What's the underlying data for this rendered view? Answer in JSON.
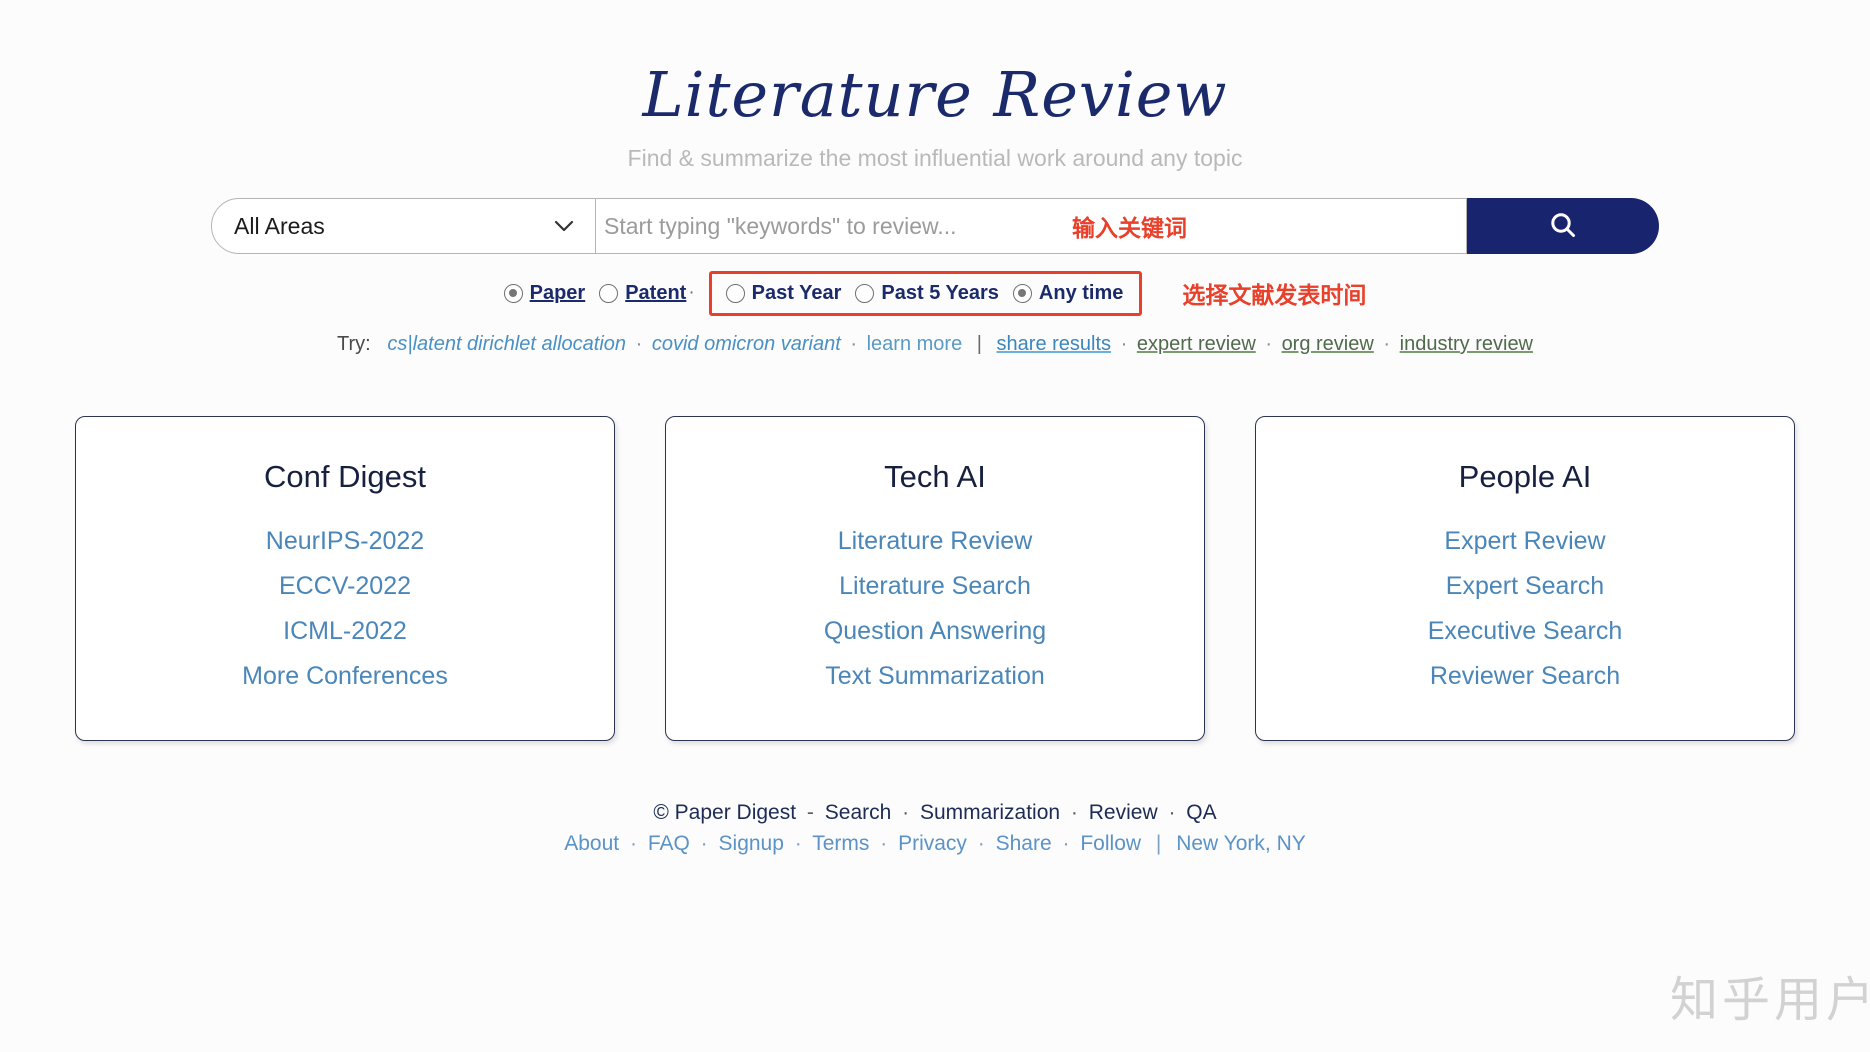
{
  "header": {
    "title": "Literature Review",
    "tagline": "Find & summarize the most influential work around any topic"
  },
  "search": {
    "area_selected": "All Areas",
    "area_options": [
      "All Areas"
    ],
    "placeholder": "Start typing \"keywords\" to review...",
    "value": "",
    "annotation_keyword": "输入关键词",
    "search_icon": "search-icon"
  },
  "filters": {
    "doc_types": [
      {
        "label": "Paper",
        "selected": true
      },
      {
        "label": "Patent",
        "selected": false
      }
    ],
    "separator": "·",
    "time_ranges": [
      {
        "label": "Past Year",
        "selected": false
      },
      {
        "label": "Past 5 Years",
        "selected": false
      },
      {
        "label": "Any time",
        "selected": true
      }
    ],
    "annotation_time": "选择文献发表时间",
    "annotation_color": "#e8402a"
  },
  "try_row": {
    "label": "Try:",
    "examples": [
      "cs|latent dirichlet allocation",
      "covid omicron variant"
    ],
    "learn_more": "learn more",
    "pipe": "|",
    "share_results": "share results",
    "green_links": [
      "expert review",
      "org review",
      "industry review"
    ],
    "dot": "·"
  },
  "cards": [
    {
      "title": "Conf Digest",
      "links": [
        "NeurIPS-2022",
        "ECCV-2022",
        "ICML-2022",
        "More Conferences"
      ]
    },
    {
      "title": "Tech AI",
      "links": [
        "Literature Review",
        "Literature Search",
        "Question Answering",
        "Text Summarization"
      ]
    },
    {
      "title": "People AI",
      "links": [
        "Expert Review",
        "Expert Search",
        "Executive Search",
        "Reviewer Search"
      ]
    }
  ],
  "footer": {
    "copyright": "© Paper Digest",
    "dash": "-",
    "services": [
      "Search",
      "Summarization",
      "Review",
      "QA"
    ],
    "links": [
      "About",
      "FAQ",
      "Signup",
      "Terms",
      "Privacy",
      "Share",
      "Follow"
    ],
    "pipe": "|",
    "location": "New York, NY",
    "dot": "·"
  },
  "watermark": {
    "text": "知乎用户"
  },
  "colors": {
    "brand_navy": "#18246d",
    "link_blue": "#4a86b8",
    "annotation_red": "#e8402a",
    "green_link": "#4f6b4c"
  }
}
